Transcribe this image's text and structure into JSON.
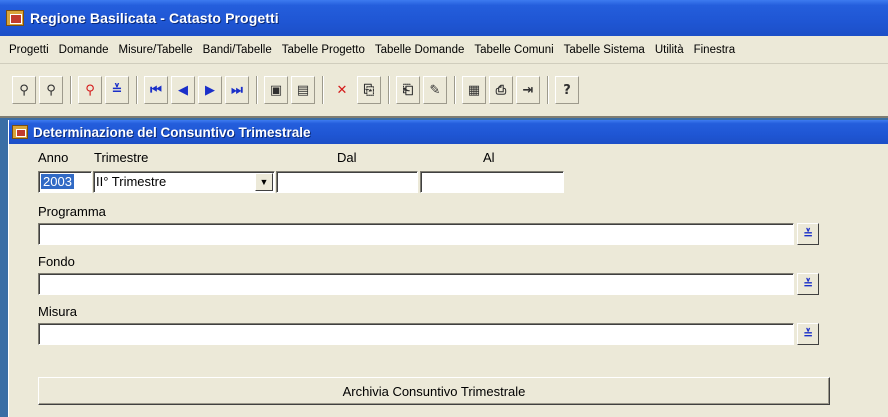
{
  "window": {
    "title": "Regione Basilicata - Catasto Progetti"
  },
  "menu": [
    "Progetti",
    "Domande",
    "Misure/Tabelle",
    "Bandi/Tabelle",
    "Tabelle Progetto",
    "Tabelle Domande",
    "Tabelle Comuni",
    "Tabelle Sistema",
    "Utilità",
    "Finestra"
  ],
  "toolbar_icons": [
    "find-icon",
    "find-next-icon",
    "find-clear-icon",
    "list-icon",
    "first-record-icon",
    "previous-record-icon",
    "next-record-icon",
    "last-record-icon",
    "new-record-icon",
    "save-icon",
    "delete-icon",
    "copy-icon",
    "paste-icon",
    "edit-icon",
    "report-icon",
    "print-icon",
    "exit-icon",
    "help-icon"
  ],
  "form": {
    "title": "Determinazione del Consuntivo Trimestrale",
    "anno_label": "Anno",
    "anno_value": "2003",
    "trimestre_label": "Trimestre",
    "trimestre_value": "II° Trimestre",
    "dal_label": "Dal",
    "dal_value": "",
    "al_label": "Al",
    "al_value": "",
    "programma_label": "Programma",
    "programma_value": "",
    "fondo_label": "Fondo",
    "fondo_value": "",
    "misura_label": "Misura",
    "misura_value": "",
    "archive_button": "Archivia Consuntivo Trimestrale"
  }
}
